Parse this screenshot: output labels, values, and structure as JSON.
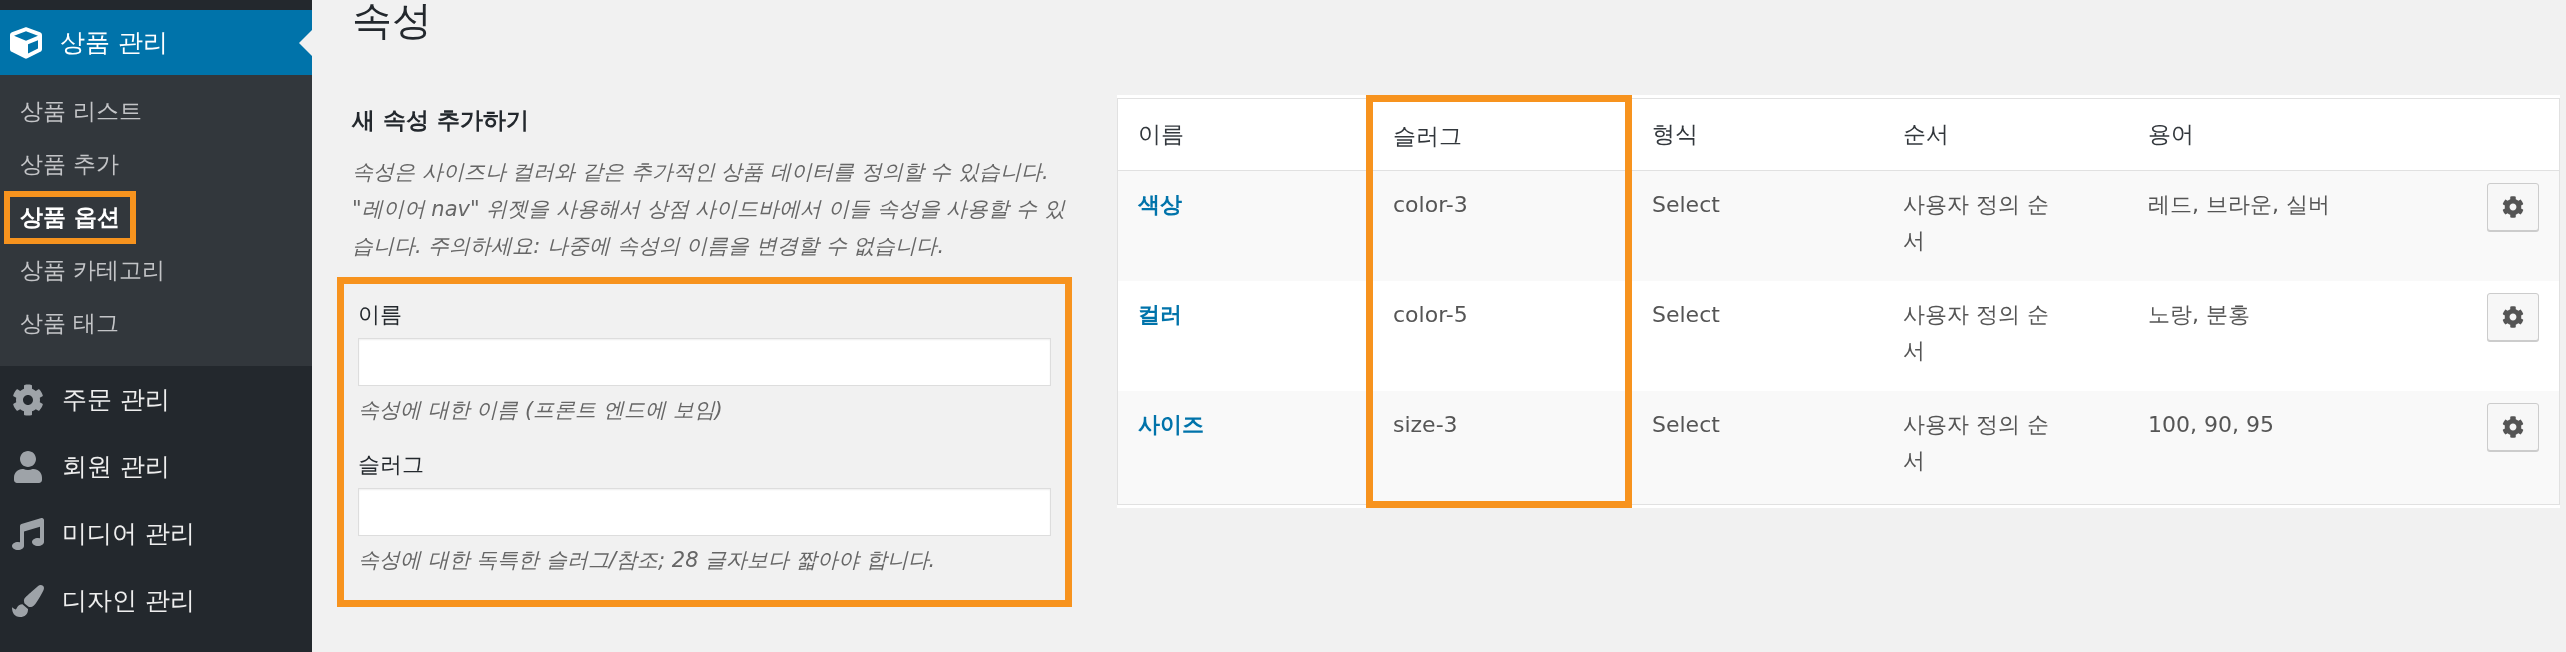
{
  "sidebar": {
    "active_menu": {
      "label": "상품 관리",
      "selected": true
    },
    "submenu": [
      {
        "label": "상품 리스트",
        "selected": false,
        "highlighted": false
      },
      {
        "label": "상품 추가",
        "selected": false,
        "highlighted": false
      },
      {
        "label": "상품 옵션",
        "selected": true,
        "highlighted": true
      },
      {
        "label": "상품 카테고리",
        "selected": false,
        "highlighted": false
      },
      {
        "label": "상품 태그",
        "selected": false,
        "highlighted": false
      }
    ],
    "menu": [
      {
        "label": "주문 관리"
      },
      {
        "label": "회원 관리"
      },
      {
        "label": "미디어 관리"
      },
      {
        "label": "디자인 관리"
      }
    ]
  },
  "page_title": "속성",
  "form": {
    "heading": "새 속성 추가하기",
    "description": "속성은 사이즈나 컬러와 같은 추가적인 상품 데이터를 정의할 수 있습니다. \"레이어 nav\" 위젯을 사용해서 상점 사이드바에서 이들 속성을 사용할 수 있습니다. 주의하세요: 나중에 속성의 이름을 변경할 수 없습니다.",
    "highlighted": true,
    "fields": [
      {
        "label": "이름",
        "hint": "속성에 대한 이름 (프론트 엔드에 보임)"
      },
      {
        "label": "슬러그",
        "hint": "속성에 대한 독특한 슬러그/참조; 28 글자보다 짧아야 합니다."
      }
    ]
  },
  "table": {
    "columns": [
      {
        "label": "이름",
        "highlighted": false
      },
      {
        "label": "슬러그",
        "highlighted": true
      },
      {
        "label": "형식",
        "highlighted": false
      },
      {
        "label": "순서",
        "highlighted": false
      },
      {
        "label": "용어",
        "highlighted": false
      }
    ],
    "rows": [
      {
        "name": "색상",
        "slug": "color-3",
        "type": "Select",
        "order": "사용자 정의 순서",
        "terms": "레드, 브라운, 실버"
      },
      {
        "name": "컬러",
        "slug": "color-5",
        "type": "Select",
        "order": "사용자 정의 순서",
        "terms": "노랑, 분홍"
      },
      {
        "name": "사이즈",
        "slug": "size-3",
        "type": "Select",
        "order": "사용자 정의 순서",
        "terms": "100, 90, 95"
      }
    ]
  }
}
